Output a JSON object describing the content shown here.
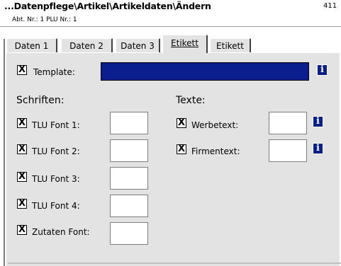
{
  "header": {
    "title": "...Datenpflege\\Artikel\\Artikeldaten\\Ändern",
    "number": "411",
    "subtitle": "Abt. Nr.: 1  PLU Nr.: 1"
  },
  "tabs": [
    {
      "label": "Daten 1",
      "active": false
    },
    {
      "label": "Daten 2",
      "active": false
    },
    {
      "label": "Daten 3",
      "active": false
    },
    {
      "label": "Etikett",
      "active": true
    },
    {
      "label": "Etikett",
      "active": false
    }
  ],
  "template": {
    "checked": true,
    "check_mark": "X",
    "label": "Template:",
    "value": "",
    "info_icon": "i"
  },
  "schriften": {
    "heading": "Schriften:",
    "items": [
      {
        "label": "TLU Font 1:",
        "checked": true,
        "value": ""
      },
      {
        "label": "TLU Font 2:",
        "checked": true,
        "value": ""
      },
      {
        "label": "TLU Font 3:",
        "checked": true,
        "value": ""
      },
      {
        "label": "TLU Font 4:",
        "checked": true,
        "value": ""
      },
      {
        "label": "Zutaten Font:",
        "checked": true,
        "value": ""
      }
    ]
  },
  "texte": {
    "heading": "Texte:",
    "items": [
      {
        "label": "Werbetext:",
        "checked": true,
        "value": "",
        "info_icon": "i"
      },
      {
        "label": "Firmentext:",
        "checked": true,
        "value": "",
        "info_icon": "i"
      }
    ]
  },
  "colors": {
    "selection_blue": "#0a1e8c",
    "panel_bg": "#e3e3e3"
  }
}
